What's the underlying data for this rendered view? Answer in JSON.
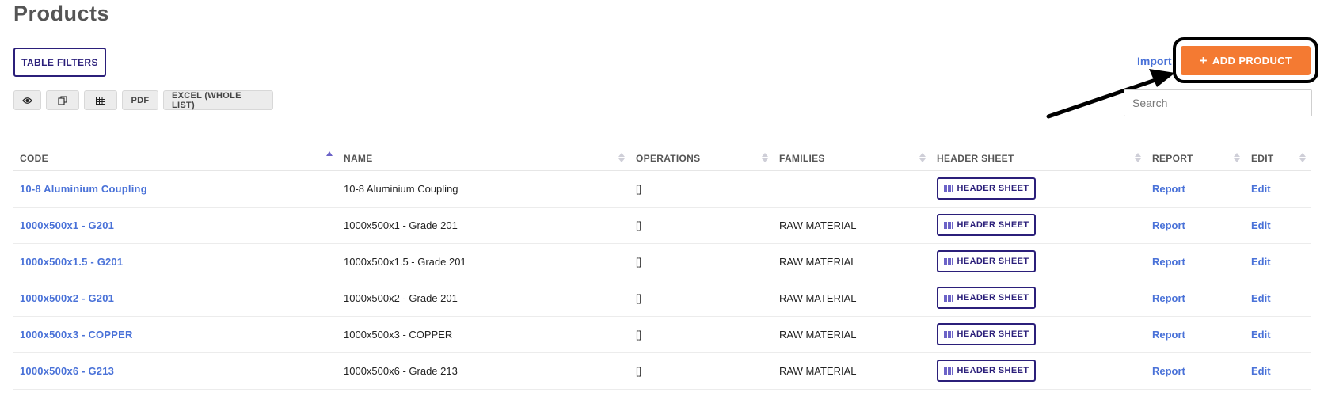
{
  "page": {
    "title": "Products"
  },
  "toolbar": {
    "filters_label": "TABLE FILTERS",
    "pdf_label": "PDF",
    "excel_label": "EXCEL (WHOLE LIST)",
    "import_label": "Import",
    "add_plus": "+",
    "add_label": "ADD PRODUCT"
  },
  "search": {
    "placeholder": "Search",
    "value": ""
  },
  "table": {
    "columns": [
      "CODE",
      "NAME",
      "OPERATIONS",
      "FAMILIES",
      "HEADER SHEET",
      "REPORT",
      "EDIT"
    ],
    "sorted_column": "CODE",
    "header_sheet_label": "HEADER SHEET",
    "report_label": "Report",
    "edit_label": "Edit",
    "rows": [
      {
        "code": "10-8 Aluminium Coupling",
        "name": "10-8 Aluminium Coupling",
        "operations": "[]",
        "families": ""
      },
      {
        "code": "1000x500x1 - G201",
        "name": "1000x500x1 - Grade 201",
        "operations": "[]",
        "families": "RAW MATERIAL"
      },
      {
        "code": "1000x500x1.5 - G201",
        "name": "1000x500x1.5 - Grade 201",
        "operations": "[]",
        "families": "RAW MATERIAL"
      },
      {
        "code": "1000x500x2 - G201",
        "name": "1000x500x2 - Grade 201",
        "operations": "[]",
        "families": "RAW MATERIAL"
      },
      {
        "code": "1000x500x3 - COPPER",
        "name": "1000x500x3 - COPPER",
        "operations": "[]",
        "families": "RAW MATERIAL"
      },
      {
        "code": "1000x500x6 - G213",
        "name": "1000x500x6 - Grade 213",
        "operations": "[]",
        "families": "RAW MATERIAL"
      }
    ]
  },
  "colors": {
    "accent_orange": "#f47a32",
    "link_blue": "#4a72d8",
    "header_sheet_purple": "#2b1f7a"
  },
  "icons": {
    "visibility": "eye-icon",
    "copy": "copy-icon",
    "csv": "table-icon",
    "header_sheet": "barcode-icon",
    "annotation": "arrow-annotation"
  }
}
